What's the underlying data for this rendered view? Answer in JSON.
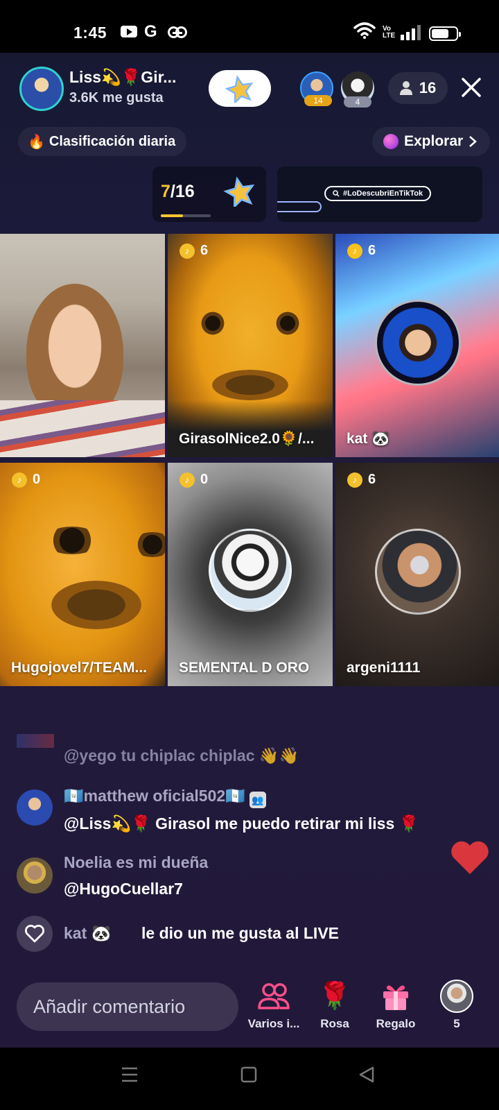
{
  "status_bar": {
    "time": "1:45",
    "g_label": "G",
    "lte_label": "Vo\nLTE"
  },
  "header": {
    "host_name": "Liss💫🌹Gir...",
    "likes": "3.6K me gusta",
    "top_viewers": [
      {
        "badge": "14"
      },
      {
        "badge": "4"
      }
    ],
    "viewer_count": "16"
  },
  "ranking": {
    "label": "Clasificación diaria",
    "emoji": "👆"
  },
  "explore": {
    "label": "Explorar"
  },
  "task": {
    "current": "7",
    "total": "/16",
    "progress": 0.44
  },
  "banner": {
    "hashtag": "#LoDescubriEnTikTok"
  },
  "guests": [
    {
      "name": "",
      "coins": ""
    },
    {
      "name": "GirasolNice2.0🌻/...",
      "coins": "6"
    },
    {
      "name": "kat 🐼",
      "coins": "6"
    },
    {
      "name": "Hugojovel7/TEAM...",
      "coins": "0"
    },
    {
      "name": "SEMENTAL D ORO",
      "coins": "0"
    },
    {
      "name": "argeni1111",
      "coins": "6"
    }
  ],
  "chat": [
    {
      "user": "",
      "message": "@yego tu chiplac chiplac 👋👋"
    },
    {
      "user": "🇬🇹matthew oficial502🇬🇹",
      "message": "@Liss💫🌹 Girasol me puedo retirar mi liss 🌹"
    },
    {
      "user": "Noelia es mi dueña",
      "message": "@HugoCuellar7"
    },
    {
      "user": "kat 🐼",
      "message": "le dio un me gusta al LIVE"
    }
  ],
  "bottom_bar": {
    "comment_placeholder": "Añadir comentario",
    "actions": [
      {
        "label": "Varios i...",
        "icon": "guests-icon"
      },
      {
        "label": "Rosa",
        "icon": "rose-icon"
      },
      {
        "label": "Regalo",
        "icon": "gift-icon"
      },
      {
        "label": "5",
        "icon": "profile-avatar"
      }
    ]
  },
  "colors": {
    "accent_gold": "#f7c531",
    "background": "#1c1a3a",
    "heart_red": "#d9363e",
    "guests_pink": "#ff4f8b"
  }
}
